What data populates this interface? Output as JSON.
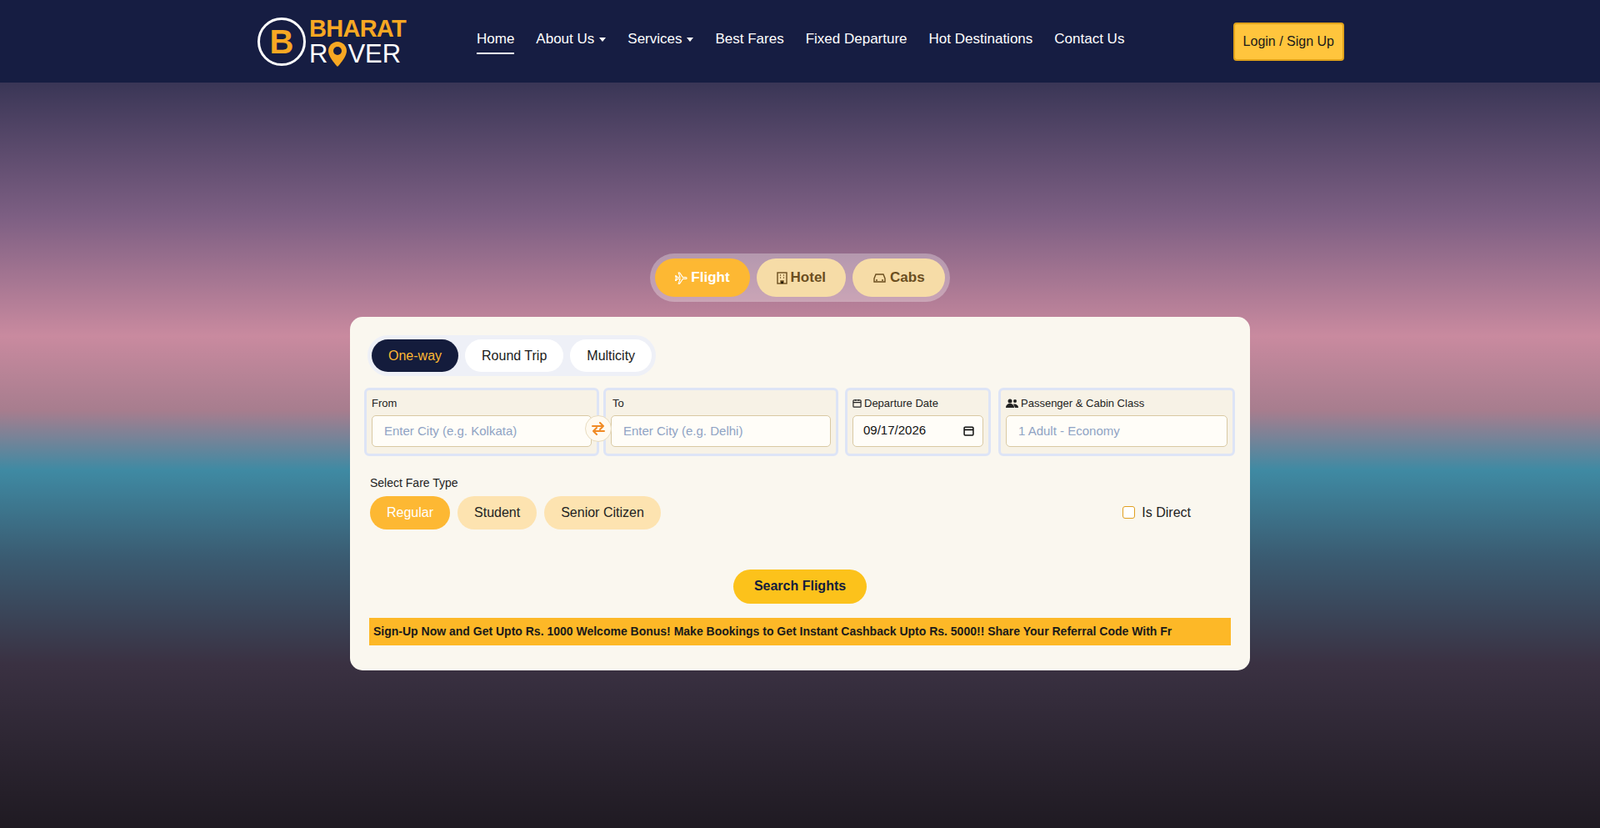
{
  "logo": {
    "badge": "B",
    "top": "BHARAT",
    "bottom_left": "R",
    "bottom_right": "VER"
  },
  "nav": {
    "items": [
      {
        "label": "Home",
        "selected": true,
        "has_dropdown": false
      },
      {
        "label": "About Us",
        "selected": false,
        "has_dropdown": true
      },
      {
        "label": "Services",
        "selected": false,
        "has_dropdown": true
      },
      {
        "label": "Best Fares",
        "selected": false,
        "has_dropdown": false
      },
      {
        "label": "Fixed Departure",
        "selected": false,
        "has_dropdown": false
      },
      {
        "label": "Hot Destinations",
        "selected": false,
        "has_dropdown": false
      },
      {
        "label": "Contact Us",
        "selected": false,
        "has_dropdown": false
      }
    ]
  },
  "login_button": "Login / Sign Up",
  "service_tabs": [
    {
      "label": "Flight",
      "selected": true,
      "kind": "flight"
    },
    {
      "label": "Hotel",
      "selected": false,
      "kind": "hotel"
    },
    {
      "label": "Cabs",
      "selected": false,
      "kind": "cabs"
    }
  ],
  "trip_types": [
    {
      "label": "One-way",
      "selected": true
    },
    {
      "label": "Round Trip",
      "selected": false
    },
    {
      "label": "Multicity",
      "selected": false
    }
  ],
  "fields": {
    "from": {
      "label": "From",
      "placeholder": "Enter City (e.g. Kolkata)"
    },
    "to": {
      "label": "To",
      "placeholder": "Enter City (e.g. Delhi)"
    },
    "departure": {
      "label": "Departure Date",
      "value": "09/17/2026"
    },
    "passenger": {
      "label": "Passenger & Cabin Class",
      "placeholder": "1 Adult - Economy"
    }
  },
  "fare_type": {
    "label": "Select Fare Type",
    "options": [
      {
        "label": "Regular",
        "selected": true
      },
      {
        "label": "Student",
        "selected": false
      },
      {
        "label": "Senior Citizen",
        "selected": false
      }
    ]
  },
  "is_direct": {
    "label": "Is Direct",
    "checked": false
  },
  "search_button": "Search Flights",
  "marquee": "Sign-Up Now and Get Upto Rs. 1000 Welcome Bonus! Make Bookings to Get Instant Cashback Upto Rs. 5000!! Share Your Referral Code With Fr"
}
